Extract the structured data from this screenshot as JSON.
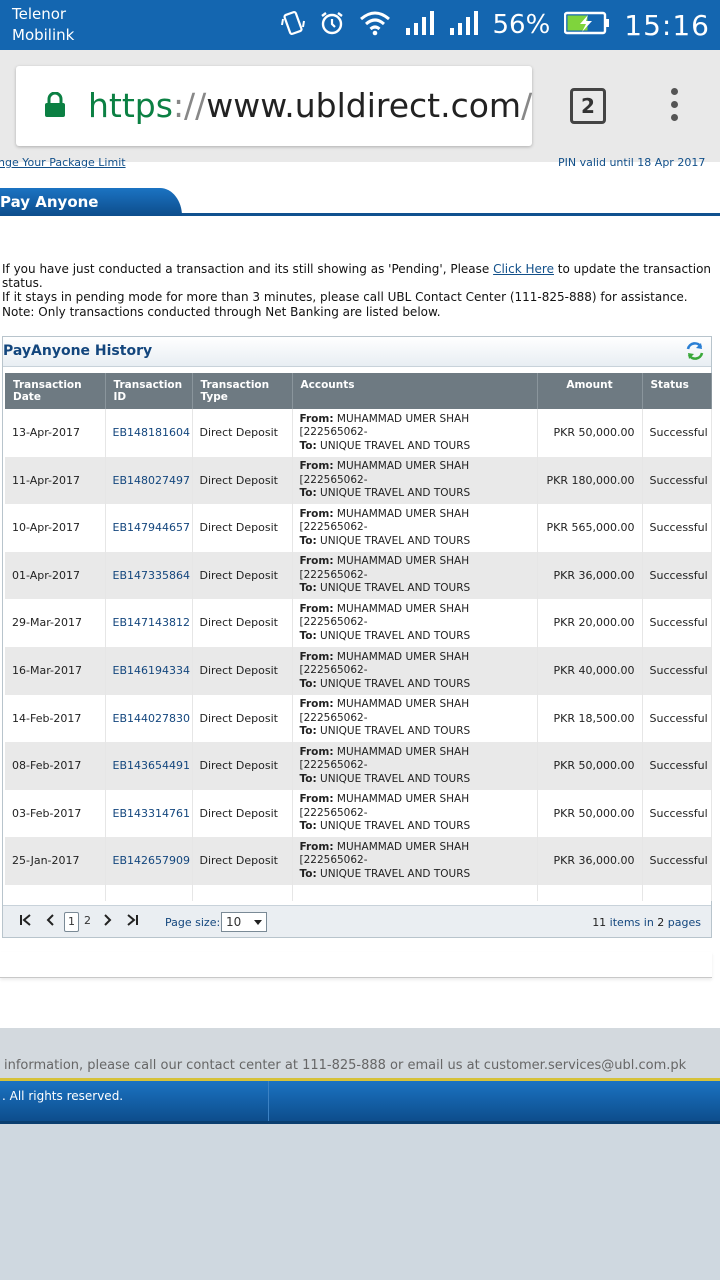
{
  "status_bar": {
    "carrier_line1": "Telenor",
    "carrier_line2": "Mobilink",
    "battery": "56%",
    "time": "15:16"
  },
  "browser": {
    "url_scheme": "https",
    "url_slashes": "://",
    "url_host": "www.ubldirect.com",
    "url_path": "/gn",
    "tab_count": "2"
  },
  "page": {
    "top_link_left": "nge Your Package Limit",
    "top_link_right": "PIN valid until 18 Apr 2017",
    "tab_title": "Pay Anyone",
    "notice_before": "If you have just conducted a transaction and its still showing as 'Pending', Please ",
    "notice_link": "Click Here",
    "notice_after": " to update the transaction status.",
    "notice_line2": "If it stays in pending mode for more than 3 minutes, please call UBL Contact Center (111-825-888) for assistance.",
    "note": "Note: Only transactions conducted through Net Banking are listed below."
  },
  "history": {
    "title": "PayAnyone History",
    "columns": {
      "date": "Transaction Date",
      "id": "Transaction ID",
      "type": "Transaction Type",
      "accounts": "Accounts",
      "amount": "Amount",
      "status": "Status"
    },
    "from_label": "From:",
    "to_label": "To:",
    "rows": [
      {
        "date": "13-Apr-2017",
        "id": "EB148181604",
        "type": "Direct Deposit",
        "from": "MUHAMMAD UMER SHAH",
        "from_acct": "[222565062-",
        "to": "UNIQUE TRAVEL AND TOURS",
        "amount": "PKR 50,000.00",
        "status": "Successful"
      },
      {
        "date": "11-Apr-2017",
        "id": "EB148027497",
        "type": "Direct Deposit",
        "from": "MUHAMMAD UMER SHAH",
        "from_acct": "[222565062-",
        "to": "UNIQUE TRAVEL AND TOURS",
        "amount": "PKR 180,000.00",
        "status": "Successful"
      },
      {
        "date": "10-Apr-2017",
        "id": "EB147944657",
        "type": "Direct Deposit",
        "from": "MUHAMMAD UMER SHAH",
        "from_acct": "[222565062-",
        "to": "UNIQUE TRAVEL AND TOURS",
        "amount": "PKR 565,000.00",
        "status": "Successful"
      },
      {
        "date": "01-Apr-2017",
        "id": "EB147335864",
        "type": "Direct Deposit",
        "from": "MUHAMMAD UMER SHAH",
        "from_acct": "[222565062-",
        "to": "UNIQUE TRAVEL AND TOURS",
        "amount": "PKR 36,000.00",
        "status": "Successful"
      },
      {
        "date": "29-Mar-2017",
        "id": "EB147143812",
        "type": "Direct Deposit",
        "from": "MUHAMMAD UMER SHAH",
        "from_acct": "[222565062-",
        "to": "UNIQUE TRAVEL AND TOURS",
        "amount": "PKR 20,000.00",
        "status": "Successful"
      },
      {
        "date": "16-Mar-2017",
        "id": "EB146194334",
        "type": "Direct Deposit",
        "from": "MUHAMMAD UMER SHAH",
        "from_acct": "[222565062-",
        "to": "UNIQUE TRAVEL AND TOURS",
        "amount": "PKR 40,000.00",
        "status": "Successful"
      },
      {
        "date": "14-Feb-2017",
        "id": "EB144027830",
        "type": "Direct Deposit",
        "from": "MUHAMMAD UMER SHAH",
        "from_acct": "[222565062-",
        "to": "UNIQUE TRAVEL AND TOURS",
        "amount": "PKR 18,500.00",
        "status": "Successful"
      },
      {
        "date": "08-Feb-2017",
        "id": "EB143654491",
        "type": "Direct Deposit",
        "from": "MUHAMMAD UMER SHAH",
        "from_acct": "[222565062-",
        "to": "UNIQUE TRAVEL AND TOURS",
        "amount": "PKR 50,000.00",
        "status": "Successful"
      },
      {
        "date": "03-Feb-2017",
        "id": "EB143314761",
        "type": "Direct Deposit",
        "from": "MUHAMMAD UMER SHAH",
        "from_acct": "[222565062-",
        "to": "UNIQUE TRAVEL AND TOURS",
        "amount": "PKR 50,000.00",
        "status": "Successful"
      },
      {
        "date": "25-Jan-2017",
        "id": "EB142657909",
        "type": "Direct Deposit",
        "from": "MUHAMMAD UMER SHAH",
        "from_acct": "[222565062-",
        "to": "UNIQUE TRAVEL AND TOURS",
        "amount": "PKR 36,000.00",
        "status": "Successful"
      }
    ]
  },
  "pager": {
    "page1": "1",
    "page2": "2",
    "page_size_label": "Page size:",
    "page_size_value": "10",
    "items_count": "11",
    "items_label": " items in ",
    "pages_count": "2",
    "pages_label": " pages"
  },
  "footer": {
    "info": " information, please call our contact center at 111-825-888 or email us at customer.services@ubl.com.pk",
    "rights": ". All rights reserved."
  },
  "colors": {
    "brand_blue": "#1466b0",
    "header_gray": "#6e7a82",
    "link_blue": "#13467d",
    "secure_green": "#0b8043"
  }
}
